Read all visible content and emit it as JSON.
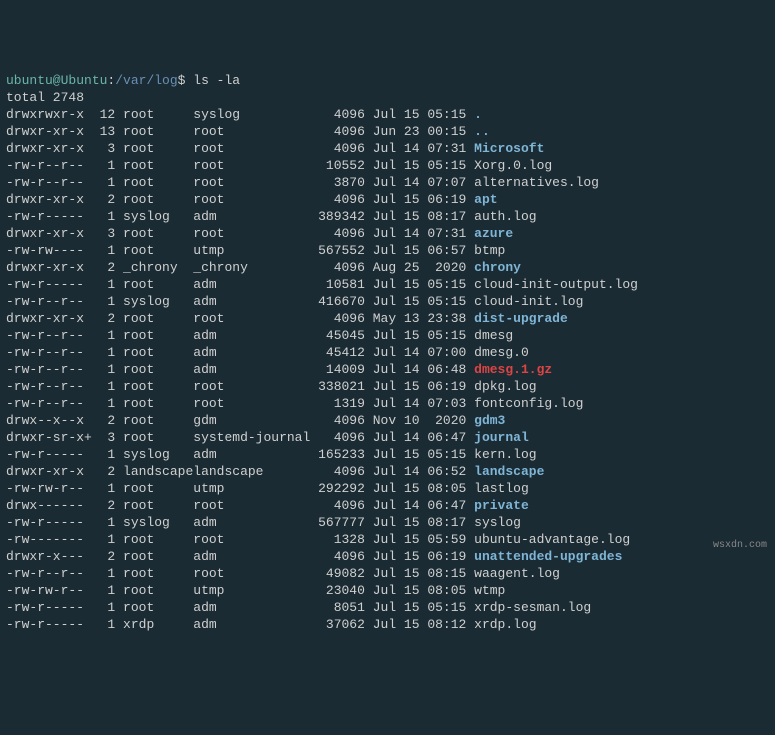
{
  "prompt": {
    "userhost": "ubuntu@Ubuntu",
    "colon": ":",
    "path": "/var/log",
    "dollar": "$ ",
    "command": "ls -la"
  },
  "total_line": "total 2748",
  "files": [
    {
      "perms": "drwxrwxr-x",
      "links": "12",
      "owner": "root",
      "group": "syslog",
      "size": "4096",
      "date": "Jul 15 05:15",
      "name": ".",
      "type": "dir"
    },
    {
      "perms": "drwxr-xr-x",
      "links": "13",
      "owner": "root",
      "group": "root",
      "size": "4096",
      "date": "Jun 23 00:15",
      "name": "..",
      "type": "dir"
    },
    {
      "perms": "drwxr-xr-x",
      "links": "3",
      "owner": "root",
      "group": "root",
      "size": "4096",
      "date": "Jul 14 07:31",
      "name": "Microsoft",
      "type": "dir"
    },
    {
      "perms": "-rw-r--r--",
      "links": "1",
      "owner": "root",
      "group": "root",
      "size": "10552",
      "date": "Jul 15 05:15",
      "name": "Xorg.0.log",
      "type": "file"
    },
    {
      "perms": "-rw-r--r--",
      "links": "1",
      "owner": "root",
      "group": "root",
      "size": "3870",
      "date": "Jul 14 07:07",
      "name": "alternatives.log",
      "type": "file"
    },
    {
      "perms": "drwxr-xr-x",
      "links": "2",
      "owner": "root",
      "group": "root",
      "size": "4096",
      "date": "Jul 15 06:19",
      "name": "apt",
      "type": "dir"
    },
    {
      "perms": "-rw-r-----",
      "links": "1",
      "owner": "syslog",
      "group": "adm",
      "size": "389342",
      "date": "Jul 15 08:17",
      "name": "auth.log",
      "type": "file"
    },
    {
      "perms": "drwxr-xr-x",
      "links": "3",
      "owner": "root",
      "group": "root",
      "size": "4096",
      "date": "Jul 14 07:31",
      "name": "azure",
      "type": "dir"
    },
    {
      "perms": "-rw-rw----",
      "links": "1",
      "owner": "root",
      "group": "utmp",
      "size": "567552",
      "date": "Jul 15 06:57",
      "name": "btmp",
      "type": "file"
    },
    {
      "perms": "drwxr-xr-x",
      "links": "2",
      "owner": "_chrony",
      "group": "_chrony",
      "size": "4096",
      "date": "Aug 25  2020",
      "name": "chrony",
      "type": "dir"
    },
    {
      "perms": "-rw-r-----",
      "links": "1",
      "owner": "root",
      "group": "adm",
      "size": "10581",
      "date": "Jul 15 05:15",
      "name": "cloud-init-output.log",
      "type": "file"
    },
    {
      "perms": "-rw-r--r--",
      "links": "1",
      "owner": "syslog",
      "group": "adm",
      "size": "416670",
      "date": "Jul 15 05:15",
      "name": "cloud-init.log",
      "type": "file"
    },
    {
      "perms": "drwxr-xr-x",
      "links": "2",
      "owner": "root",
      "group": "root",
      "size": "4096",
      "date": "May 13 23:38",
      "name": "dist-upgrade",
      "type": "dir"
    },
    {
      "perms": "-rw-r--r--",
      "links": "1",
      "owner": "root",
      "group": "adm",
      "size": "45045",
      "date": "Jul 15 05:15",
      "name": "dmesg",
      "type": "file"
    },
    {
      "perms": "-rw-r--r--",
      "links": "1",
      "owner": "root",
      "group": "adm",
      "size": "45412",
      "date": "Jul 14 07:00",
      "name": "dmesg.0",
      "type": "file"
    },
    {
      "perms": "-rw-r--r--",
      "links": "1",
      "owner": "root",
      "group": "adm",
      "size": "14009",
      "date": "Jul 14 06:48",
      "name": "dmesg.1.gz",
      "type": "gz"
    },
    {
      "perms": "-rw-r--r--",
      "links": "1",
      "owner": "root",
      "group": "root",
      "size": "338021",
      "date": "Jul 15 06:19",
      "name": "dpkg.log",
      "type": "file"
    },
    {
      "perms": "-rw-r--r--",
      "links": "1",
      "owner": "root",
      "group": "root",
      "size": "1319",
      "date": "Jul 14 07:03",
      "name": "fontconfig.log",
      "type": "file"
    },
    {
      "perms": "drwx--x--x",
      "links": "2",
      "owner": "root",
      "group": "gdm",
      "size": "4096",
      "date": "Nov 10  2020",
      "name": "gdm3",
      "type": "dir"
    },
    {
      "perms": "drwxr-sr-x+",
      "links": "3",
      "owner": "root",
      "group": "systemd-journal",
      "size": "4096",
      "date": "Jul 14 06:47",
      "name": "journal",
      "type": "dir"
    },
    {
      "perms": "-rw-r-----",
      "links": "1",
      "owner": "syslog",
      "group": "adm",
      "size": "165233",
      "date": "Jul 15 05:15",
      "name": "kern.log",
      "type": "file"
    },
    {
      "perms": "drwxr-xr-x",
      "links": "2",
      "owner": "landscape",
      "group": "landscape",
      "size": "4096",
      "date": "Jul 14 06:52",
      "name": "landscape",
      "type": "dir"
    },
    {
      "perms": "-rw-rw-r--",
      "links": "1",
      "owner": "root",
      "group": "utmp",
      "size": "292292",
      "date": "Jul 15 08:05",
      "name": "lastlog",
      "type": "file"
    },
    {
      "perms": "drwx------",
      "links": "2",
      "owner": "root",
      "group": "root",
      "size": "4096",
      "date": "Jul 14 06:47",
      "name": "private",
      "type": "dir"
    },
    {
      "perms": "-rw-r-----",
      "links": "1",
      "owner": "syslog",
      "group": "adm",
      "size": "567777",
      "date": "Jul 15 08:17",
      "name": "syslog",
      "type": "file"
    },
    {
      "perms": "-rw-------",
      "links": "1",
      "owner": "root",
      "group": "root",
      "size": "1328",
      "date": "Jul 15 05:59",
      "name": "ubuntu-advantage.log",
      "type": "file"
    },
    {
      "perms": "drwxr-x---",
      "links": "2",
      "owner": "root",
      "group": "adm",
      "size": "4096",
      "date": "Jul 15 06:19",
      "name": "unattended-upgrades",
      "type": "dir"
    },
    {
      "perms": "-rw-r--r--",
      "links": "1",
      "owner": "root",
      "group": "root",
      "size": "49082",
      "date": "Jul 15 08:15",
      "name": "waagent.log",
      "type": "file"
    },
    {
      "perms": "-rw-rw-r--",
      "links": "1",
      "owner": "root",
      "group": "utmp",
      "size": "23040",
      "date": "Jul 15 08:05",
      "name": "wtmp",
      "type": "file"
    },
    {
      "perms": "-rw-r-----",
      "links": "1",
      "owner": "root",
      "group": "adm",
      "size": "8051",
      "date": "Jul 15 05:15",
      "name": "xrdp-sesman.log",
      "type": "file"
    },
    {
      "perms": "-rw-r-----",
      "links": "1",
      "owner": "xrdp",
      "group": "adm",
      "size": "37062",
      "date": "Jul 15 08:12",
      "name": "xrdp.log",
      "type": "file"
    }
  ],
  "watermark": "wsxdn.com"
}
